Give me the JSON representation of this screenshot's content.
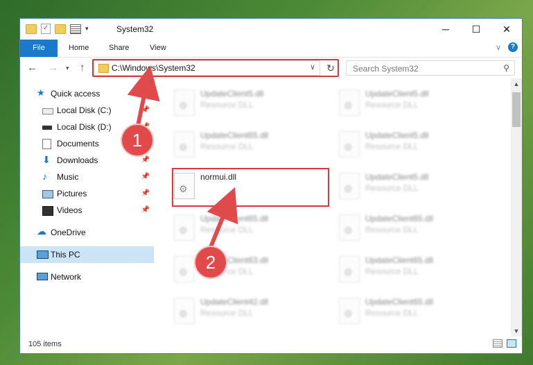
{
  "window": {
    "title": "System32",
    "controls": [
      "─",
      "☐",
      "✕"
    ]
  },
  "ribbon": {
    "tabs": [
      "File",
      "Home",
      "Share",
      "View"
    ]
  },
  "navigation": {
    "address": "C:\\Windows\\System32",
    "search_placeholder": "Search System32"
  },
  "sidebar": {
    "items": [
      {
        "label": "Quick access",
        "icon": "star-icon",
        "pinned": false
      },
      {
        "label": "Local Disk (C:)",
        "icon": "drive-icon",
        "pinned": true
      },
      {
        "label": "Local Disk (D:)",
        "icon": "drive-icon",
        "pinned": true
      },
      {
        "label": "Documents",
        "icon": "document-icon",
        "pinned": true
      },
      {
        "label": "Downloads",
        "icon": "download-icon",
        "pinned": true
      },
      {
        "label": "Music",
        "icon": "music-icon",
        "pinned": true
      },
      {
        "label": "Pictures",
        "icon": "pictures-icon",
        "pinned": true
      },
      {
        "label": "Videos",
        "icon": "videos-icon",
        "pinned": true
      },
      {
        "label": "OneDrive",
        "icon": "cloud-icon",
        "pinned": false
      },
      {
        "label": "This PC",
        "icon": "computer-icon",
        "pinned": false,
        "selected": true
      },
      {
        "label": "Network",
        "icon": "network-icon",
        "pinned": false
      }
    ]
  },
  "files": {
    "left_column": [
      {
        "name": "UpdateClient5.dll",
        "type": "Resource DLL"
      },
      {
        "name": "UpdateClient65.dll",
        "type": "Resource DLL"
      },
      {
        "name": "normui.dll",
        "type": ""
      },
      {
        "name": "UpdateClient65.dll",
        "type": "Resource DLL"
      },
      {
        "name": "UpdateClient63.dll",
        "type": "Resource DLL"
      },
      {
        "name": "UpdateClient42.dll",
        "type": "Resource DLL"
      }
    ],
    "right_column": [
      {
        "name": "UpdateClient5.dll",
        "type": "Resource DLL"
      },
      {
        "name": "UpdateClient5.dll",
        "type": "Resource DLL"
      },
      {
        "name": "UpdateClient5.dll",
        "type": "Resource DLL"
      },
      {
        "name": "UpdateClient65.dll",
        "type": "Resource DLL"
      },
      {
        "name": "UpdateClient65.dll",
        "type": "Resource DLL"
      },
      {
        "name": "UpdateClient65.dll",
        "type": "Resource DLL"
      }
    ]
  },
  "status": {
    "item_count": "105 items"
  },
  "annotations": {
    "step1": "1",
    "step2": "2",
    "color": "#e04a4a"
  }
}
